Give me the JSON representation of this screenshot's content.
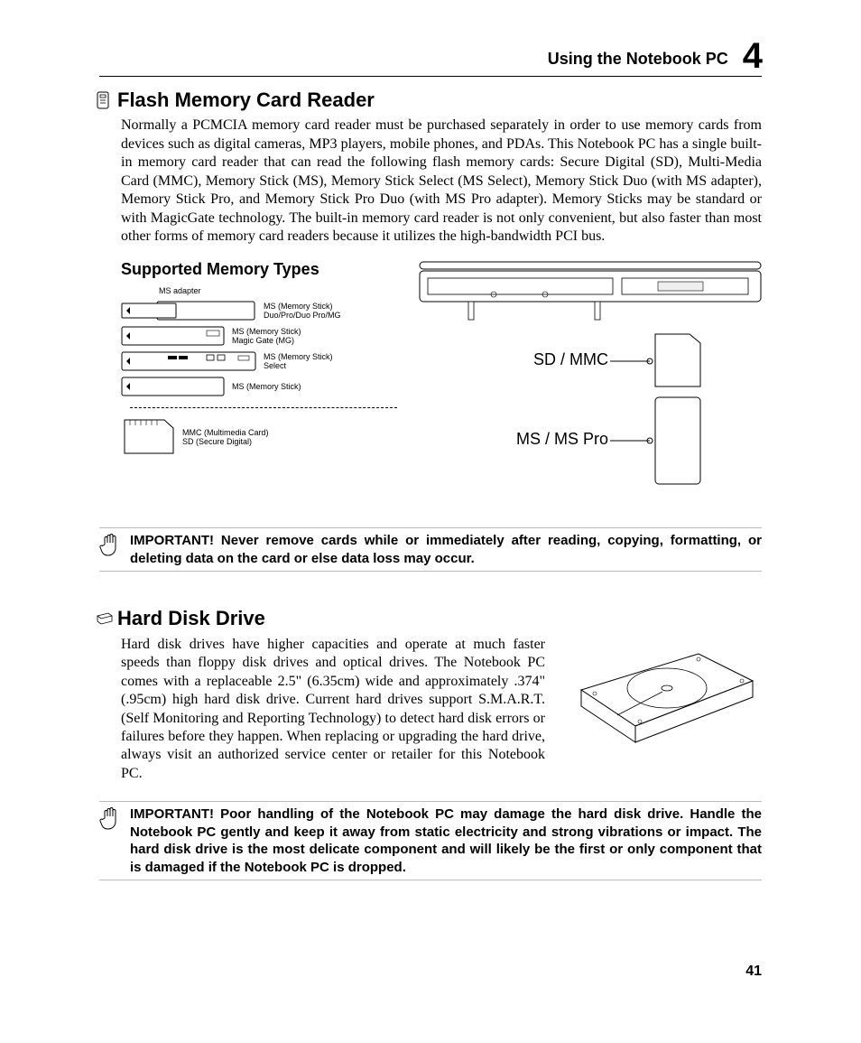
{
  "header": {
    "title": "Using the Notebook PC",
    "chapter": "4"
  },
  "section1": {
    "title": "Flash Memory Card Reader",
    "body": "Normally a PCMCIA memory card reader must be purchased separately in order to use memory cards from devices such as digital cameras, MP3 players, mobile phones, and PDAs. This Notebook PC has a single built-in memory card reader that can read the following flash memory cards: Secure Digital (SD), Multi-Media Card (MMC), Memory Stick (MS), Memory Stick Select (MS Select), Memory Stick Duo (with MS adapter), Memory Stick Pro, and Memory Stick Pro Duo (with MS Pro adapter). Memory Sticks may be standard or with MagicGate technology. The built-in memory card reader is not only convenient, but also faster than most other forms of memory card readers because it utilizes the high-bandwidth PCI bus."
  },
  "memory": {
    "sub_heading": "Supported Memory Types",
    "adapter_label": "MS adapter",
    "row1": "MS (Memory Stick)\nDuo/Pro/Duo Pro/MG",
    "row2": "MS (Memory Stick)\nMagic Gate (MG)",
    "row3": "MS (Memory Stick)\nSelect",
    "row4": "MS (Memory Stick)",
    "row5": "MMC (Multimedia Card)\nSD (Secure Digital)",
    "slot1": "SD / MMC",
    "slot2": "MS / MS Pro"
  },
  "important1": "IMPORTANT!  Never remove cards while or immediately after reading, copying, formatting, or deleting data on the card or else data loss may occur.",
  "section2": {
    "title": "Hard Disk Drive",
    "body": "Hard disk drives have higher capacities and operate at much faster speeds than floppy disk drives and optical drives. The Notebook PC comes with a replaceable 2.5\" (6.35cm) wide and approximately .374\" (.95cm) high hard disk drive. Current hard drives support S.M.A.R.T. (Self Monitoring and Reporting Technology) to detect hard disk errors or failures before they happen. When replacing or upgrading the hard drive, always visit an authorized service center or retailer for this Notebook PC."
  },
  "important2": "IMPORTANT!  Poor handling of the Notebook PC may damage the hard disk drive. Handle the Notebook PC gently and keep it away from static electricity and strong vibrations or impact. The hard disk drive is the most delicate component and will likely be the first or only component that is damaged if the Notebook PC is dropped.",
  "page_number": "41"
}
